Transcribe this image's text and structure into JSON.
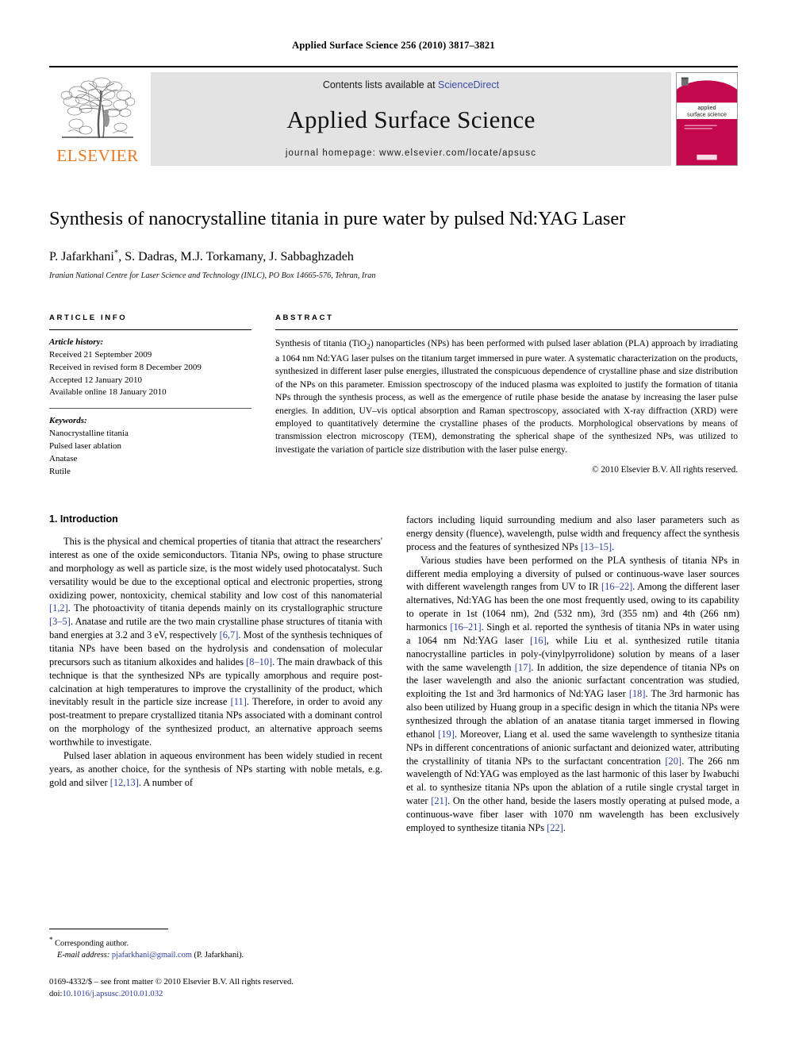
{
  "running_head": "Applied Surface Science 256 (2010) 3817–3821",
  "masthead": {
    "publisher_name": "ELSEVIER",
    "contents_prefix": "Contents lists available at ",
    "contents_link": "ScienceDirect",
    "journal_title": "Applied Surface Science",
    "homepage": "journal homepage: www.elsevier.com/locate/apsusc",
    "cover": {
      "line1": "applied",
      "line2": "surface science",
      "accent_color": "#c3094b"
    },
    "link_color": "#3a4aa8",
    "logo_color": "#E87722"
  },
  "article": {
    "title": "Synthesis of nanocrystalline titania in pure water by pulsed Nd:YAG Laser",
    "authors": "P. Jafarkhani, S. Dadras, M.J. Torkamany, J. Sabbaghzadeh",
    "corresponding_marker": "*",
    "affiliation": "Iranian National Centre for Laser Science and Technology (INLC), PO Box 14665-576, Tehran, Iran"
  },
  "article_info": {
    "heading": "ARTICLE INFO",
    "history_label": "Article history:",
    "history": [
      "Received 21 September 2009",
      "Received in revised form 8 December 2009",
      "Accepted 12 January 2010",
      "Available online 18 January 2010"
    ],
    "keywords_label": "Keywords:",
    "keywords": [
      "Nanocrystalline titania",
      "Pulsed laser ablation",
      "Anatase",
      "Rutile"
    ]
  },
  "abstract": {
    "heading": "ABSTRACT",
    "text": "Synthesis of titania (TiO2) nanoparticles (NPs) has been performed with pulsed laser ablation (PLA) approach by irradiating a 1064 nm Nd:YAG laser pulses on the titanium target immersed in pure water. A systematic characterization on the products, synthesized in different laser pulse energies, illustrated the conspicuous dependence of crystalline phase and size distribution of the NPs on this parameter. Emission spectroscopy of the induced plasma was exploited to justify the formation of titania NPs through the synthesis process, as well as the emergence of rutile phase beside the anatase by increasing the laser pulse energies. In addition, UV–vis optical absorption and Raman spectroscopy, associated with X-ray diffraction (XRD) were employed to quantitatively determine the crystalline phases of the products. Morphological observations by means of transmission electron microscopy (TEM), demonstrating the spherical shape of the synthesized NPs, was utilized to investigate the variation of particle size distribution with the laser pulse energy.",
    "copyright": "© 2010 Elsevier B.V. All rights reserved."
  },
  "body": {
    "section1_title": "1. Introduction",
    "left_paragraphs": [
      "This is the physical and chemical properties of titania that attract the researchers' interest as one of the oxide semiconductors. Titania NPs, owing to phase structure and morphology as well as particle size, is the most widely used photocatalyst. Such versatility would be due to the exceptional optical and electronic properties, strong oxidizing power, nontoxicity, chemical stability and low cost of this nanomaterial [1,2]. The photoactivity of titania depends mainly on its crystallographic structure [3–5]. Anatase and rutile are the two main crystalline phase structures of titania with band energies at 3.2 and 3 eV, respectively [6,7]. Most of the synthesis techniques of titania NPs have been based on the hydrolysis and condensation of molecular precursors such as titanium alkoxides and halides [8–10]. The main drawback of this technique is that the synthesized NPs are typically amorphous and require post-calcination at high temperatures to improve the crystallinity of the product, which inevitably result in the particle size increase [11]. Therefore, in order to avoid any post-treatment to prepare crystallized titania NPs associated with a dominant control on the morphology of the synthesized product, an alternative approach seems worthwhile to investigate.",
      "Pulsed laser ablation in aqueous environment has been widely studied in recent years, as another choice, for the synthesis of NPs starting with noble metals, e.g. gold and silver [12,13]. A number of"
    ],
    "right_paragraphs": [
      "factors including liquid surrounding medium and also laser parameters such as energy density (fluence), wavelength, pulse width and frequency affect the synthesis process and the features of synthesized NPs [13–15].",
      "Various studies have been performed on the PLA synthesis of titania NPs in different media employing a diversity of pulsed or continuous-wave laser sources with different wavelength ranges from UV to IR [16–22]. Among the different laser alternatives, Nd:YAG has been the one most frequently used, owing to its capability to operate in 1st (1064 nm), 2nd (532 nm), 3rd (355 nm) and 4th (266 nm) harmonics [16–21]. Singh et al. reported the synthesis of titania NPs in water using a 1064 nm Nd:YAG laser [16], while Liu et al. synthesized rutile titania nanocrystalline particles in poly-(vinylpyrrolidone) solution by means of a laser with the same wavelength [17]. In addition, the size dependence of titania NPs on the laser wavelength and also the anionic surfactant concentration was studied, exploiting the 1st and 3rd harmonics of Nd:YAG laser [18]. The 3rd harmonic has also been utilized by Huang group in a specific design in which the titania NPs were synthesized through the ablation of an anatase titania target immersed in flowing ethanol [19]. Moreover, Liang et al. used the same wavelength to synthesize titania NPs in different concentrations of anionic surfactant and deionized water, attributing the crystallinity of titania NPs to the surfactant concentration [20]. The 266 nm wavelength of Nd:YAG was employed as the last harmonic of this laser by Iwabuchi et al. to synthesize titania NPs upon the ablation of a rutile single crystal target in water [21]. On the other hand, beside the lasers mostly operating at pulsed mode, a continuous-wave fiber laser with 1070 nm wavelength has been exclusively employed to synthesize titania NPs [22]."
    ]
  },
  "footnotes": {
    "corresponding_author": "Corresponding author.",
    "email_label": "E-mail address:",
    "email": "pjafarkhani@gmail.com",
    "email_owner": "(P. Jafarkhani).",
    "issn_line": "0169-4332/$ – see front matter © 2010 Elsevier B.V. All rights reserved.",
    "doi_prefix": "doi:",
    "doi": "10.1016/j.apsusc.2010.01.032",
    "link_color": "#2e3f9e"
  }
}
